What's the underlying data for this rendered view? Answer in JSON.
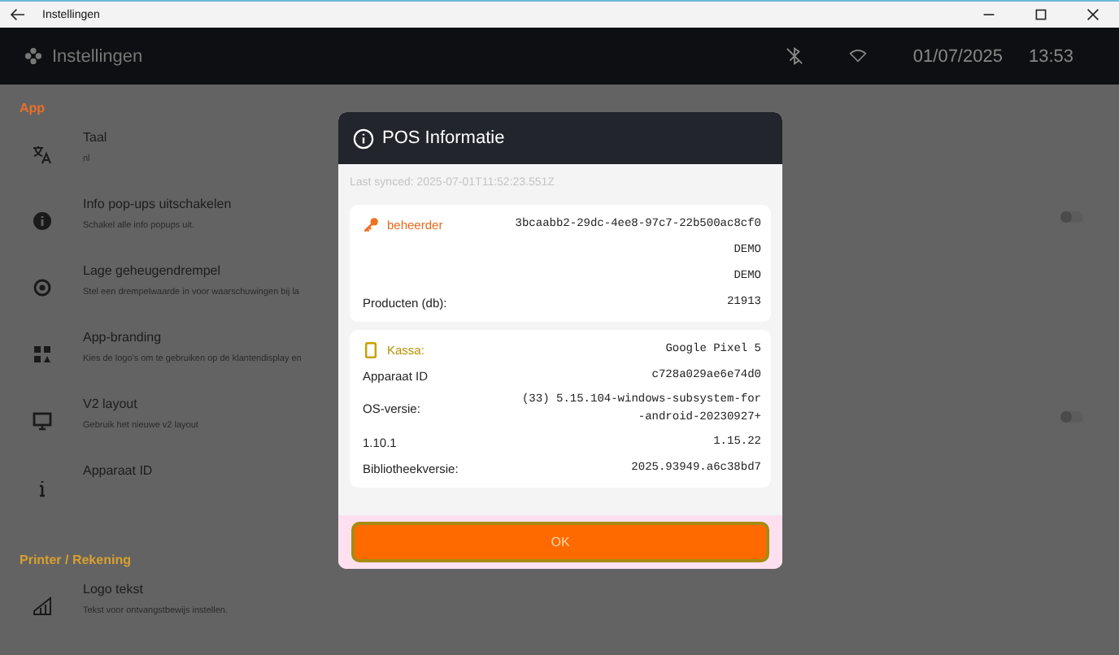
{
  "window": {
    "title": "Instellingen"
  },
  "app_bar": {
    "title": "Instellingen",
    "date": "01/07/2025",
    "time": "13:53"
  },
  "sections": [
    {
      "title": "App",
      "items": [
        {
          "kind": "text",
          "title": "Taal",
          "description": "nl"
        },
        {
          "kind": "toggle",
          "title": "Info pop-ups uitschakelen",
          "description": "Schakel alle info popups uit.",
          "on": false
        },
        {
          "kind": "text",
          "title": "Lage geheugendrempel",
          "description": "Stel een drempelwaarde in voor waarschuwingen bij la"
        },
        {
          "kind": "text",
          "title": "App-branding",
          "description": "Kies de logo's om te gebruiken op de klantendisplay en"
        },
        {
          "kind": "toggle",
          "title": "V2 layout",
          "description": "Gebruik het nieuwe v2 layout",
          "on": false
        },
        {
          "kind": "text",
          "title": "Apparaat ID"
        }
      ]
    },
    {
      "title": "Printer / Rekening",
      "items": [
        {
          "kind": "text",
          "title": "Logo tekst",
          "description": "Tekst voor ontvangstbewijs instellen."
        }
      ]
    }
  ],
  "modal": {
    "title": "POS Informatie",
    "last_synced": "Last synced: 2025-07-01T11:52:23.551Z",
    "cards": [
      {
        "kind": "key",
        "label": "beheerder",
        "value": "3bcaabb2-29dc-4ee8-97c7-22b500ac8cf0",
        "rows": [
          {
            "value": "DEMO"
          },
          {
            "value": "DEMO"
          },
          {
            "label": "Producten (db):",
            "value": "21913"
          }
        ]
      },
      {
        "kind": "device",
        "label": "Kassa:",
        "value": "Google Pixel 5",
        "rows": [
          {
            "label": "Apparaat ID",
            "value": "c728a029ae6e74d0"
          },
          {
            "label": "OS-versie:",
            "value": "(33) 5.15.104-windows-subsystem-for-android-20230927+"
          },
          {
            "label": "1.10.1",
            "value": "1.15.22"
          },
          {
            "label": "Bibliotheekversie:",
            "value": "2025.93949.a6c38bd7"
          }
        ]
      }
    ],
    "button": "OK"
  }
}
